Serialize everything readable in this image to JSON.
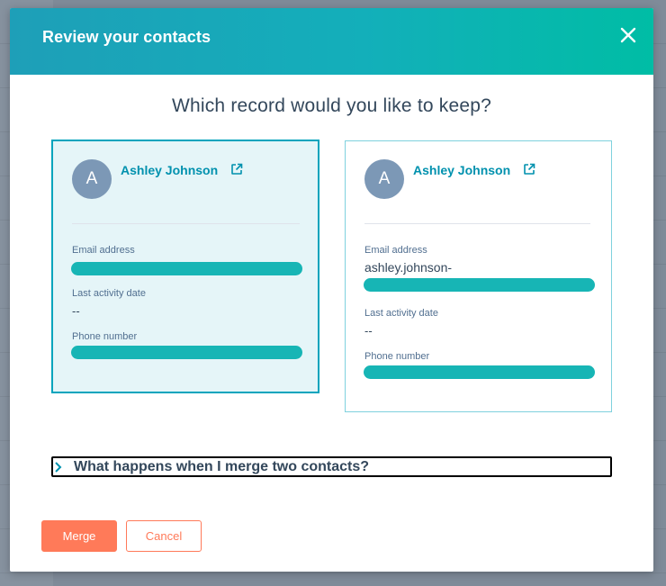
{
  "modal": {
    "title": "Review your contacts",
    "question": "Which record would you like to keep?"
  },
  "records": [
    {
      "avatar_initial": "A",
      "name": "Ashley Johnson",
      "selected": true,
      "fields": {
        "email_label": "Email address",
        "email_value_visible": "",
        "last_activity_label": "Last activity date",
        "last_activity_value": "--",
        "phone_label": "Phone number"
      }
    },
    {
      "avatar_initial": "A",
      "name": "Ashley Johnson",
      "selected": false,
      "fields": {
        "email_label": "Email address",
        "email_value_visible": "ashley.johnson-",
        "last_activity_label": "Last activity date",
        "last_activity_value": "--",
        "phone_label": "Phone number"
      }
    }
  ],
  "faq": {
    "label": "What happens when I merge two contacts?"
  },
  "actions": {
    "merge_label": "Merge",
    "cancel_label": "Cancel"
  },
  "icons": {
    "close": "close-icon",
    "external_link": "external-link-icon",
    "faq_toggle": "chevron-right-icon"
  },
  "colors": {
    "header_gradient_start": "#1e9fb8",
    "header_gradient_end": "#00bda5",
    "link": "#0091ae",
    "primary_button": "#ff7a59",
    "selected_card_bg": "#e5f5f8",
    "selected_card_border": "#00a4bd",
    "redaction": "#17b5b5",
    "avatar": "#7c98b6"
  }
}
